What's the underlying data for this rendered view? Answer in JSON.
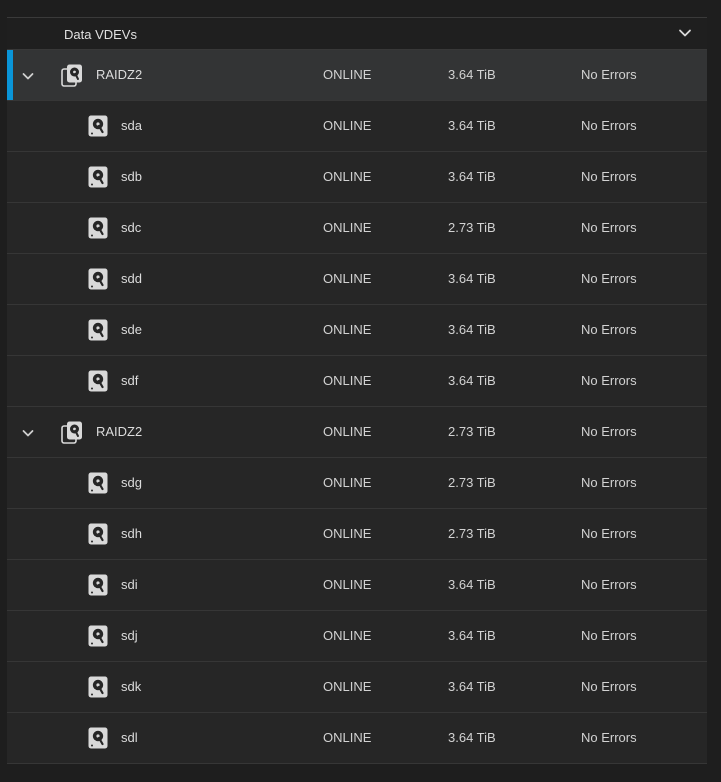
{
  "section": {
    "title": "Data VDEVs",
    "collapse_icon": "chevron-down-icon"
  },
  "vdevs": [
    {
      "name": "RAIDZ2",
      "status": "ONLINE",
      "size": "3.64 TiB",
      "errors": "No Errors",
      "selected": true,
      "disks": [
        {
          "name": "sda",
          "status": "ONLINE",
          "size": "3.64 TiB",
          "errors": "No Errors"
        },
        {
          "name": "sdb",
          "status": "ONLINE",
          "size": "3.64 TiB",
          "errors": "No Errors"
        },
        {
          "name": "sdc",
          "status": "ONLINE",
          "size": "2.73 TiB",
          "errors": "No Errors"
        },
        {
          "name": "sdd",
          "status": "ONLINE",
          "size": "3.64 TiB",
          "errors": "No Errors"
        },
        {
          "name": "sde",
          "status": "ONLINE",
          "size": "3.64 TiB",
          "errors": "No Errors"
        },
        {
          "name": "sdf",
          "status": "ONLINE",
          "size": "3.64 TiB",
          "errors": "No Errors"
        }
      ]
    },
    {
      "name": "RAIDZ2",
      "status": "ONLINE",
      "size": "2.73 TiB",
      "errors": "No Errors",
      "selected": false,
      "disks": [
        {
          "name": "sdg",
          "status": "ONLINE",
          "size": "2.73 TiB",
          "errors": "No Errors"
        },
        {
          "name": "sdh",
          "status": "ONLINE",
          "size": "2.73 TiB",
          "errors": "No Errors"
        },
        {
          "name": "sdi",
          "status": "ONLINE",
          "size": "3.64 TiB",
          "errors": "No Errors"
        },
        {
          "name": "sdj",
          "status": "ONLINE",
          "size": "3.64 TiB",
          "errors": "No Errors"
        },
        {
          "name": "sdk",
          "status": "ONLINE",
          "size": "3.64 TiB",
          "errors": "No Errors"
        },
        {
          "name": "sdl",
          "status": "ONLINE",
          "size": "3.64 TiB",
          "errors": "No Errors"
        }
      ]
    }
  ],
  "colors": {
    "accent": "#0a95d8",
    "row_selected": "#333435"
  }
}
